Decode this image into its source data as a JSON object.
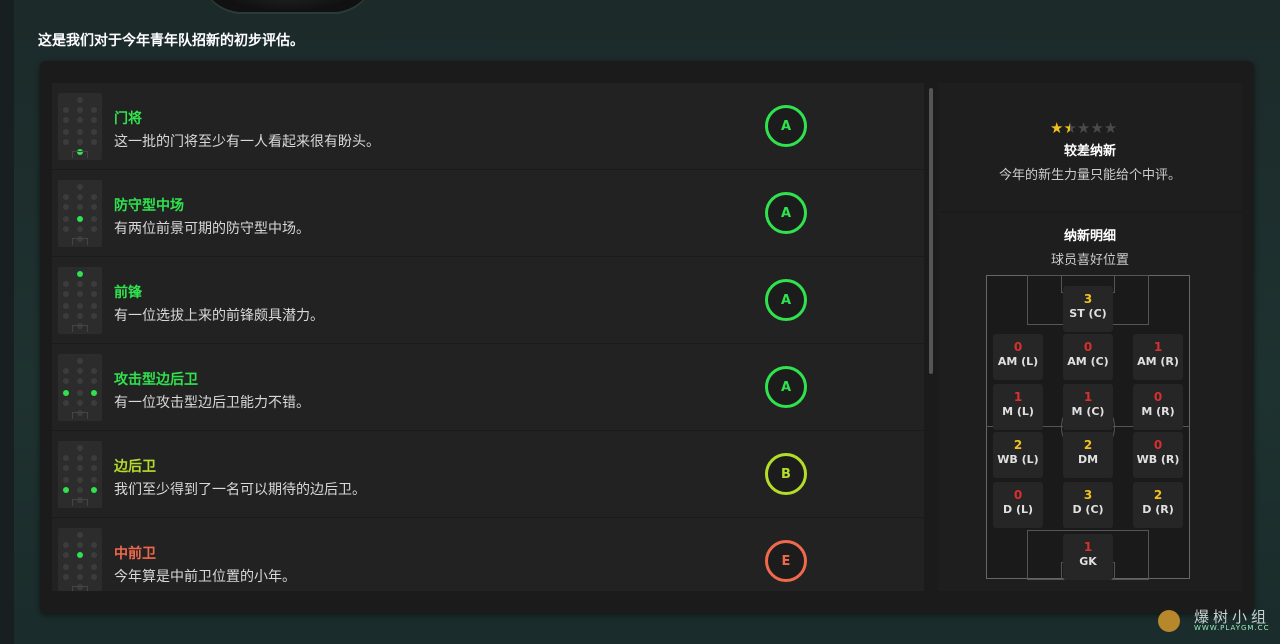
{
  "intro": "这是我们对于今年青年队招新的初步评估。",
  "colors": {
    "good": "#2fe24e",
    "ok": "#b4dd2a",
    "bad": "#f0694d"
  },
  "rows": [
    {
      "title": "门将",
      "desc": "这一批的门将至少有一人看起来很有盼头。",
      "grade": "A",
      "color": "#2fe24e",
      "dots": [
        "gk"
      ]
    },
    {
      "title": "防守型中场",
      "desc": "有两位前景可期的防守型中场。",
      "grade": "A",
      "color": "#2fe24e",
      "dots": [
        "dm"
      ]
    },
    {
      "title": "前锋",
      "desc": "有一位选拔上来的前锋颇具潜力。",
      "grade": "A",
      "color": "#2fe24e",
      "dots": [
        "st"
      ]
    },
    {
      "title": "攻击型边后卫",
      "desc": "有一位攻击型边后卫能力不错。",
      "grade": "A",
      "color": "#2fe24e",
      "dots": [
        "wbl",
        "wbr"
      ]
    },
    {
      "title": "边后卫",
      "desc": "我们至少得到了一名可以期待的边后卫。",
      "grade": "B",
      "color": "#b4dd2a",
      "dots": [
        "dl",
        "dr"
      ]
    },
    {
      "title": "中前卫",
      "desc": "今年算是中前卫位置的小年。",
      "grade": "E",
      "color": "#f0694d",
      "dots": [
        "mc"
      ]
    }
  ],
  "rating": {
    "stars_full": 1,
    "stars_half": 1,
    "stars_total": 5,
    "title": "较差纳新",
    "desc": "今年的新生力量只能给个中评。"
  },
  "breakdown": {
    "title": "纳新明细",
    "subtitle": "球员喜好位置",
    "positions": [
      {
        "key": "st",
        "n": "3",
        "label": "ST (C)",
        "color": "#f0c020"
      },
      {
        "key": "aml",
        "n": "0",
        "label": "AM (L)",
        "color": "#d83030"
      },
      {
        "key": "amc",
        "n": "0",
        "label": "AM (C)",
        "color": "#d83030"
      },
      {
        "key": "amr",
        "n": "1",
        "label": "AM (R)",
        "color": "#d83030"
      },
      {
        "key": "ml",
        "n": "1",
        "label": "M (L)",
        "color": "#d83030"
      },
      {
        "key": "mc",
        "n": "1",
        "label": "M (C)",
        "color": "#d83030"
      },
      {
        "key": "mr",
        "n": "0",
        "label": "M (R)",
        "color": "#d83030"
      },
      {
        "key": "wbl",
        "n": "2",
        "label": "WB (L)",
        "color": "#f0c020"
      },
      {
        "key": "dm",
        "n": "2",
        "label": "DM",
        "color": "#f0c020"
      },
      {
        "key": "wbr",
        "n": "0",
        "label": "WB (R)",
        "color": "#d83030"
      },
      {
        "key": "dl",
        "n": "0",
        "label": "D (L)",
        "color": "#d83030"
      },
      {
        "key": "dc",
        "n": "3",
        "label": "D (C)",
        "color": "#f0c020"
      },
      {
        "key": "dr",
        "n": "2",
        "label": "D (R)",
        "color": "#f0c020"
      },
      {
        "key": "gk",
        "n": "1",
        "label": "GK",
        "color": "#d83030"
      }
    ]
  },
  "watermark": {
    "text": "爆树小组",
    "url": "WWW.PLAYGM.CC"
  }
}
